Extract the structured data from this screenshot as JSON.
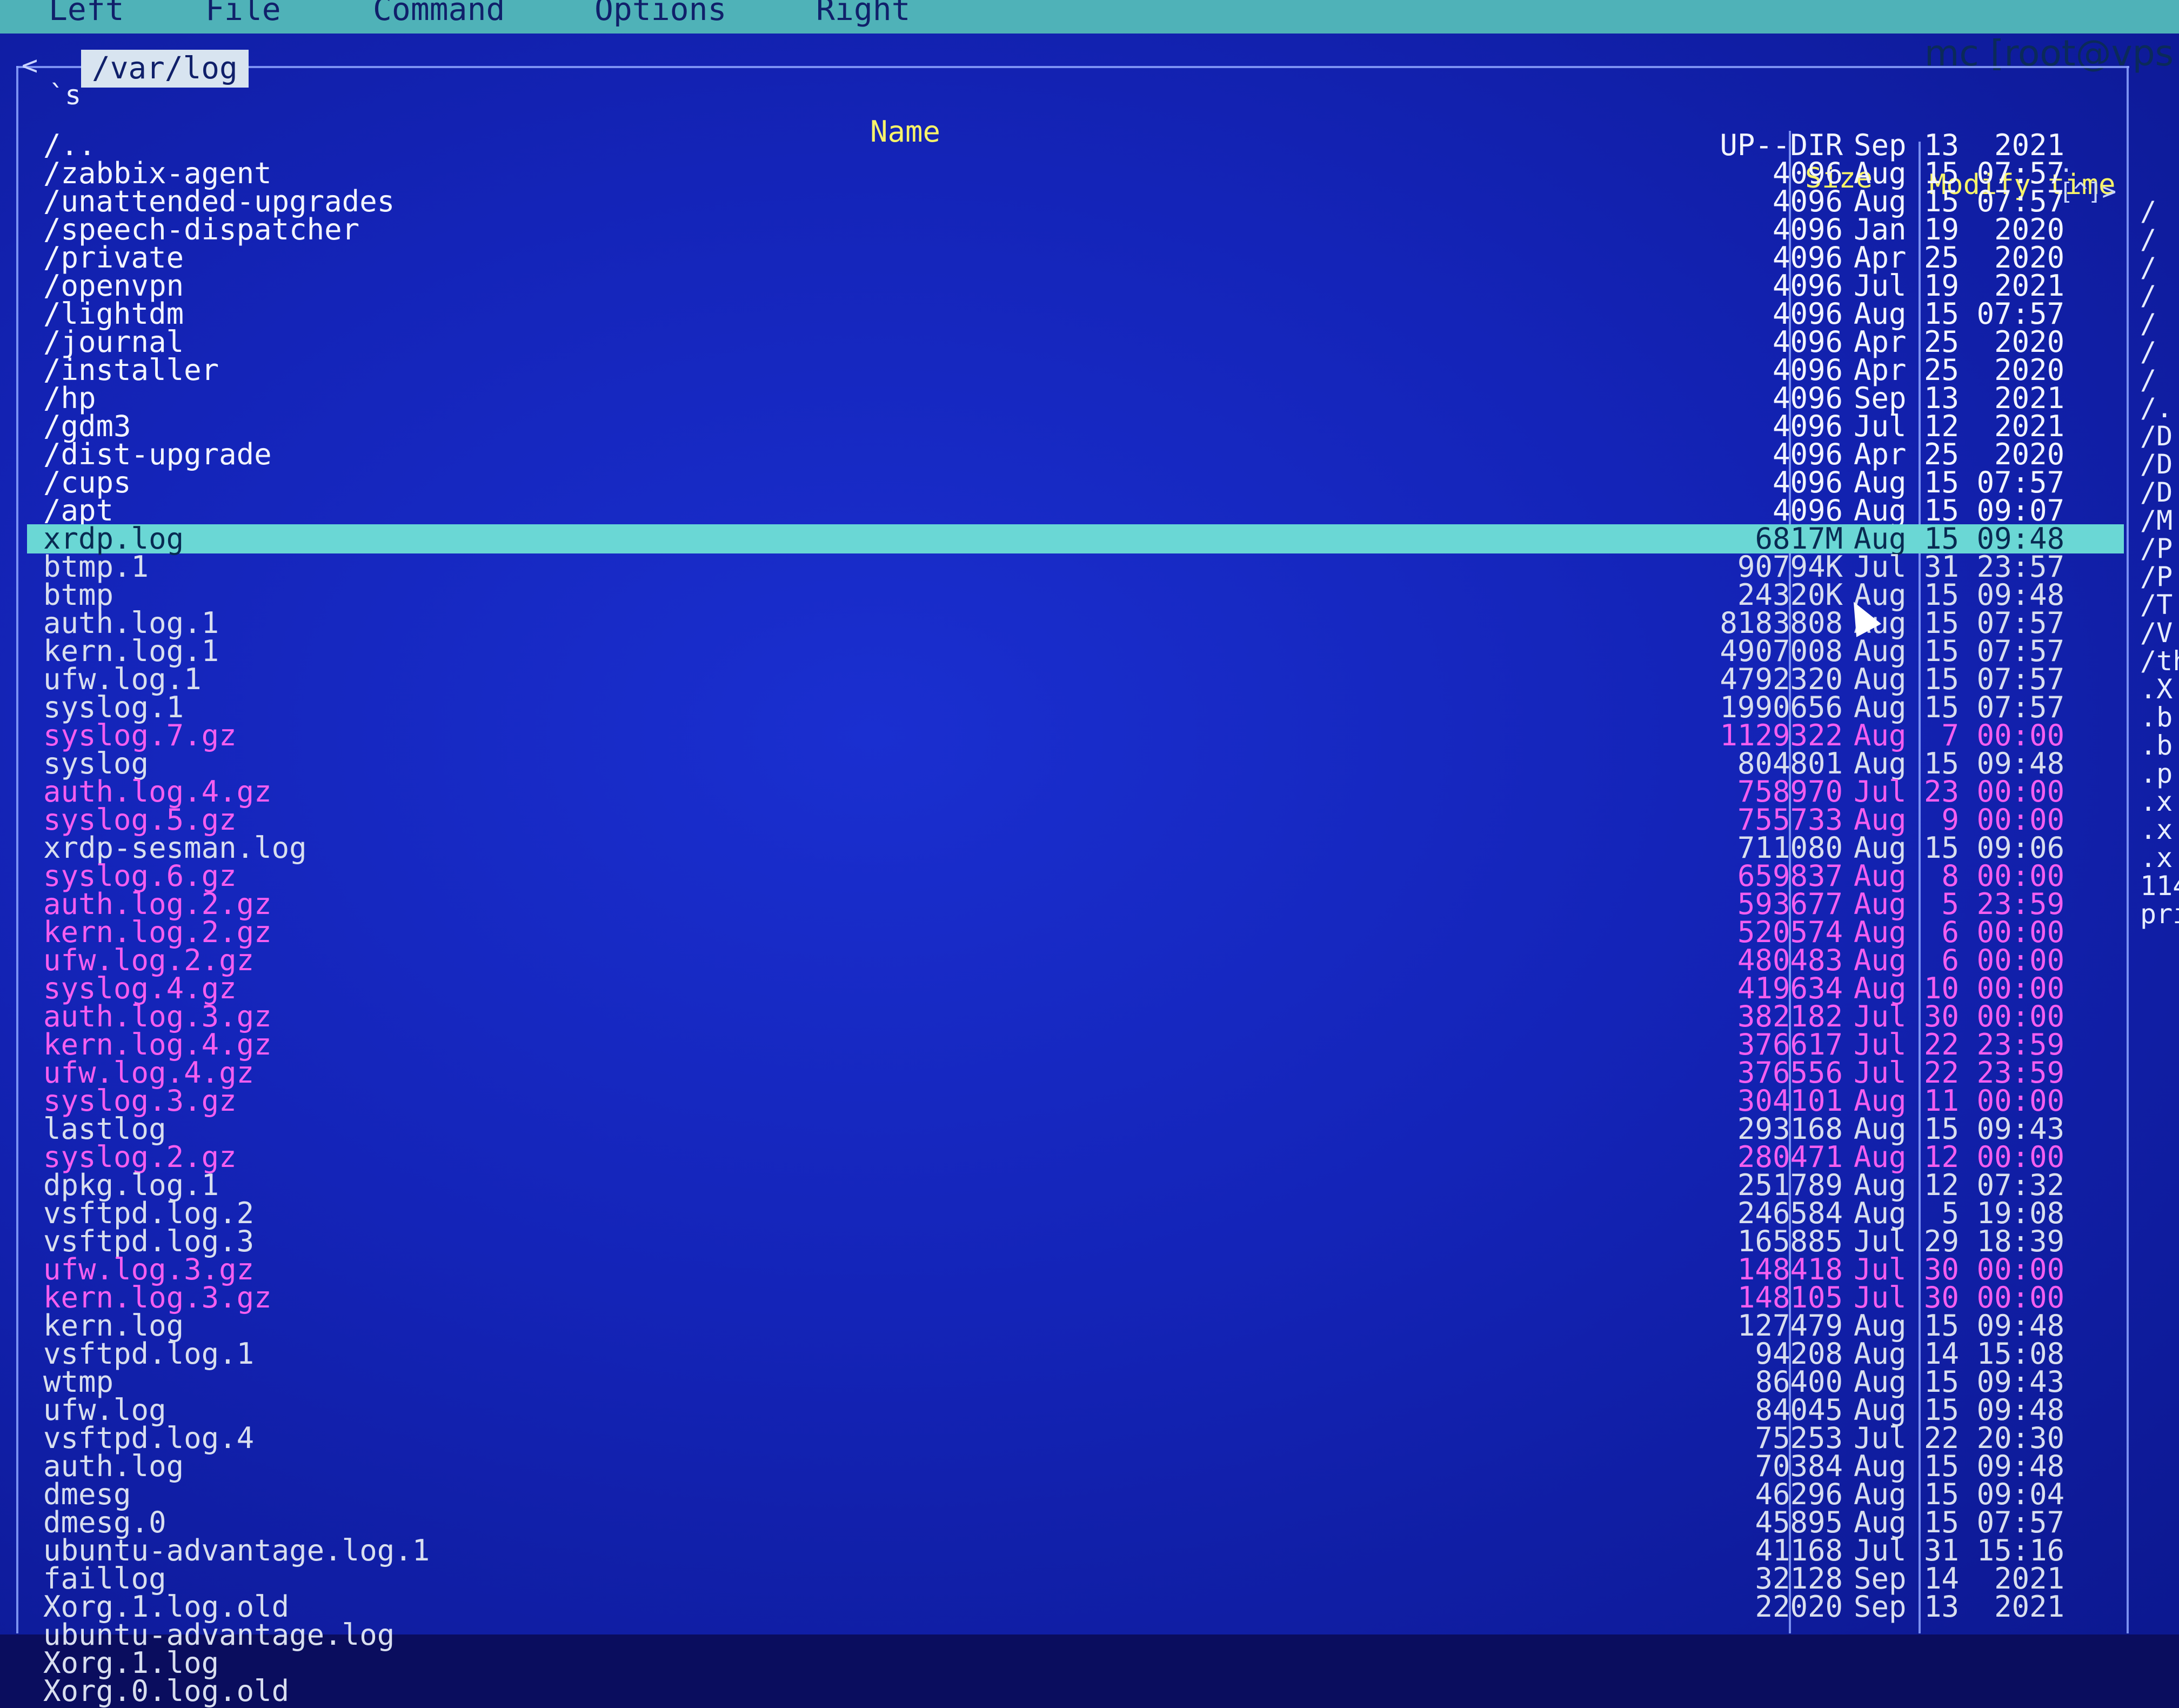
{
  "menu": {
    "items": [
      "Left",
      "File",
      "Command",
      "Options",
      "Right"
    ]
  },
  "window_title": "mc [root@vps",
  "panel": {
    "path": "/var/log",
    "hidden_label": "`s",
    "corner_mark": "<",
    "hint": ". [^]>",
    "columns": {
      "name": "Name",
      "size": "Size",
      "modify": "Modify time"
    },
    "rows": [
      {
        "name": "/..",
        "size": "UP--DIR",
        "time": "Sep 13  2021",
        "kind": "dir"
      },
      {
        "name": "/zabbix-agent",
        "size": "4096",
        "time": "Aug 15 07:57",
        "kind": "dir"
      },
      {
        "name": "/unattended-upgrades",
        "size": "4096",
        "time": "Aug 15 07:57",
        "kind": "dir"
      },
      {
        "name": "/speech-dispatcher",
        "size": "4096",
        "time": "Jan 19  2020",
        "kind": "dir"
      },
      {
        "name": "/private",
        "size": "4096",
        "time": "Apr 25  2020",
        "kind": "dir"
      },
      {
        "name": "/openvpn",
        "size": "4096",
        "time": "Jul 19  2021",
        "kind": "dir"
      },
      {
        "name": "/lightdm",
        "size": "4096",
        "time": "Aug 15 07:57",
        "kind": "dir"
      },
      {
        "name": "/journal",
        "size": "4096",
        "time": "Apr 25  2020",
        "kind": "dir"
      },
      {
        "name": "/installer",
        "size": "4096",
        "time": "Apr 25  2020",
        "kind": "dir"
      },
      {
        "name": "/hp",
        "size": "4096",
        "time": "Sep 13  2021",
        "kind": "dir"
      },
      {
        "name": "/gdm3",
        "size": "4096",
        "time": "Jul 12  2021",
        "kind": "dir"
      },
      {
        "name": "/dist-upgrade",
        "size": "4096",
        "time": "Apr 25  2020",
        "kind": "dir"
      },
      {
        "name": "/cups",
        "size": "4096",
        "time": "Aug 15 07:57",
        "kind": "dir"
      },
      {
        "name": "/apt",
        "size": "4096",
        "time": "Aug 15 09:07",
        "kind": "dir"
      },
      {
        "name": "xrdp.log",
        "size": "6817M",
        "time": "Aug 15 09:48",
        "kind": "selected"
      },
      {
        "name": "btmp.1",
        "size": "90794K",
        "time": "Jul 31 23:57",
        "kind": "file"
      },
      {
        "name": "btmp",
        "size": "24320K",
        "time": "Aug 15 09:48",
        "kind": "file"
      },
      {
        "name": "auth.log.1",
        "size": "8183808",
        "time": "Aug 15 07:57",
        "kind": "file"
      },
      {
        "name": "kern.log.1",
        "size": "4907008",
        "time": "Aug 15 07:57",
        "kind": "file"
      },
      {
        "name": "ufw.log.1",
        "size": "4792320",
        "time": "Aug 15 07:57",
        "kind": "file"
      },
      {
        "name": "syslog.1",
        "size": "1990656",
        "time": "Aug 15 07:57",
        "kind": "file"
      },
      {
        "name": "syslog.7.gz",
        "size": "1129322",
        "time": "Aug  7 00:00",
        "kind": "archive"
      },
      {
        "name": "syslog",
        "size": "804801",
        "time": "Aug 15 09:48",
        "kind": "file"
      },
      {
        "name": "auth.log.4.gz",
        "size": "758970",
        "time": "Jul 23 00:00",
        "kind": "archive"
      },
      {
        "name": "syslog.5.gz",
        "size": "755733",
        "time": "Aug  9 00:00",
        "kind": "archive"
      },
      {
        "name": "xrdp-sesman.log",
        "size": "711080",
        "time": "Aug 15 09:06",
        "kind": "file"
      },
      {
        "name": "syslog.6.gz",
        "size": "659837",
        "time": "Aug  8 00:00",
        "kind": "archive"
      },
      {
        "name": "auth.log.2.gz",
        "size": "593677",
        "time": "Aug  5 23:59",
        "kind": "archive"
      },
      {
        "name": "kern.log.2.gz",
        "size": "520574",
        "time": "Aug  6 00:00",
        "kind": "archive"
      },
      {
        "name": "ufw.log.2.gz",
        "size": "480483",
        "time": "Aug  6 00:00",
        "kind": "archive"
      },
      {
        "name": "syslog.4.gz",
        "size": "419634",
        "time": "Aug 10 00:00",
        "kind": "archive"
      },
      {
        "name": "auth.log.3.gz",
        "size": "382182",
        "time": "Jul 30 00:00",
        "kind": "archive"
      },
      {
        "name": "kern.log.4.gz",
        "size": "376617",
        "time": "Jul 22 23:59",
        "kind": "archive"
      },
      {
        "name": "ufw.log.4.gz",
        "size": "376556",
        "time": "Jul 22 23:59",
        "kind": "archive"
      },
      {
        "name": "syslog.3.gz",
        "size": "304101",
        "time": "Aug 11 00:00",
        "kind": "archive"
      },
      {
        "name": "lastlog",
        "size": "293168",
        "time": "Aug 15 09:43",
        "kind": "file"
      },
      {
        "name": "syslog.2.gz",
        "size": "280471",
        "time": "Aug 12 00:00",
        "kind": "archive"
      },
      {
        "name": "dpkg.log.1",
        "size": "251789",
        "time": "Aug 12 07:32",
        "kind": "file"
      },
      {
        "name": "vsftpd.log.2",
        "size": "246584",
        "time": "Aug  5 19:08",
        "kind": "file"
      },
      {
        "name": "vsftpd.log.3",
        "size": "165885",
        "time": "Jul 29 18:39",
        "kind": "file"
      },
      {
        "name": "ufw.log.3.gz",
        "size": "148418",
        "time": "Jul 30 00:00",
        "kind": "archive"
      },
      {
        "name": "kern.log.3.gz",
        "size": "148105",
        "time": "Jul 30 00:00",
        "kind": "archive"
      },
      {
        "name": "kern.log",
        "size": "127479",
        "time": "Aug 15 09:48",
        "kind": "file"
      },
      {
        "name": "vsftpd.log.1",
        "size": "94208",
        "time": "Aug 14 15:08",
        "kind": "file"
      },
      {
        "name": "wtmp",
        "size": "86400",
        "time": "Aug 15 09:43",
        "kind": "file"
      },
      {
        "name": "ufw.log",
        "size": "84045",
        "time": "Aug 15 09:48",
        "kind": "file"
      },
      {
        "name": "vsftpd.log.4",
        "size": "75253",
        "time": "Jul 22 20:30",
        "kind": "file"
      },
      {
        "name": "auth.log",
        "size": "70384",
        "time": "Aug 15 09:48",
        "kind": "file"
      },
      {
        "name": "dmesg",
        "size": "46296",
        "time": "Aug 15 09:04",
        "kind": "file"
      },
      {
        "name": "dmesg.0",
        "size": "45895",
        "time": "Aug 15 07:57",
        "kind": "file"
      },
      {
        "name": "ubuntu-advantage.log.1",
        "size": "41168",
        "time": "Jul 31 15:16",
        "kind": "file"
      },
      {
        "name": "faillog",
        "size": "32128",
        "time": "Sep 14  2021",
        "kind": "file"
      },
      {
        "name": "Xorg.1.log.old",
        "size": "22020",
        "time": "Sep 13  2021",
        "kind": "file"
      },
      {
        "name": "ubuntu-advantage.log",
        "size": "",
        "time": "",
        "kind": "file"
      },
      {
        "name": "Xorg.1.log",
        "size": "",
        "time": "",
        "kind": "file"
      },
      {
        "name": "Xorg.0.log.old",
        "size": "",
        "time": "",
        "kind": "file"
      }
    ]
  },
  "right_panel_fragments": [
    "/",
    "/",
    "/",
    "/",
    "/",
    "/",
    "/",
    "/.",
    "/D",
    "/D",
    "/D",
    "/M",
    "/P",
    "/P",
    "/T",
    "/V",
    "/th",
    ".X",
    ".b",
    ".b",
    ".p",
    ".x",
    ".x",
    ".x",
    "114",
    "pri"
  ],
  "colors": {
    "panel_bg": "#1424b8",
    "menu_bg": "#4fb2b8",
    "selected_bg": "#6ad7d5",
    "archive": "#f45ef0",
    "header": "#f7f36a"
  }
}
